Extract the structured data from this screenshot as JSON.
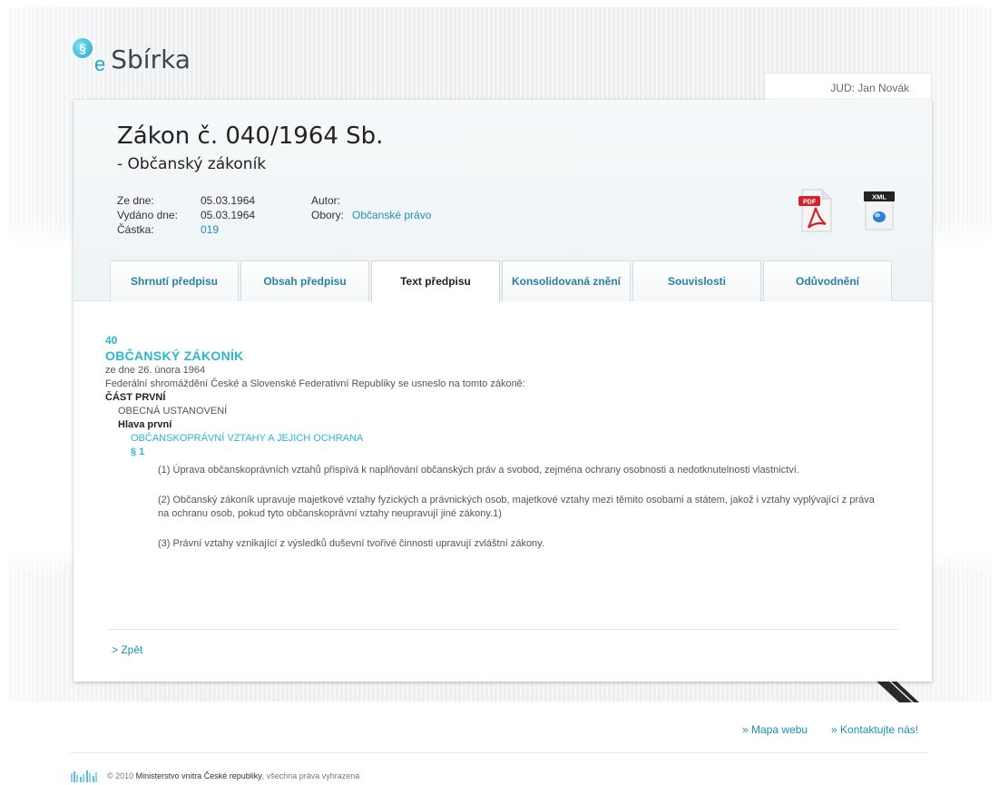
{
  "logo": {
    "mark": "§",
    "e": "e",
    "text": "Sbírka"
  },
  "user": {
    "name": "JUD: Jan Novák"
  },
  "law": {
    "title": "Zákon č. 040/1964 Sb.",
    "subtitle": "- Občanský zákoník",
    "meta_left": [
      {
        "label": "Ze dne:",
        "value": "05.03.1964",
        "is_link": false
      },
      {
        "label": "Vydáno dne:",
        "value": "05.03.1964",
        "is_link": false
      },
      {
        "label": "Částka:",
        "value": "019",
        "is_link": true
      }
    ],
    "meta_right": [
      {
        "label": "Autor:",
        "value": ""
      },
      {
        "label": "Obory:",
        "value": "Občanské právo"
      }
    ],
    "downloads": {
      "pdf_label": "PDF",
      "xml_label": "XML"
    }
  },
  "tabs": [
    {
      "label": "Shrnutí předpisu",
      "active": false
    },
    {
      "label": "Obsah předpisu",
      "active": false
    },
    {
      "label": "Text předpisu",
      "active": true
    },
    {
      "label": "Konsolidovaná znění",
      "active": false
    },
    {
      "label": "Souvislosti",
      "active": false
    },
    {
      "label": "Odůvodnění",
      "active": false
    }
  ],
  "content": {
    "number": "40",
    "title": "OBČANSKÝ ZÁKONÍK",
    "date": "ze dne 26. února 1964",
    "preamble": "Federální shromáždění České a Slovenské Federativní Republiky se usneslo na tomto zákoně:",
    "part": "ČÁST PRVNÍ",
    "part_title": "OBECNÁ USTANOVENÍ",
    "chapter": "Hlava první",
    "chapter_title": "OBČANSKOPRÁVNÍ VZTAHY A JEJICH OCHRANA",
    "section": "§ 1",
    "paragraphs": [
      "(1) Úprava občanskoprávních vztahů přispívá k naplňování občanských práv a svobod, zejména ochrany osobnosti a nedotknutelnosti vlastnictví.",
      "(2) Občanský zákoník upravuje majetkové vztahy fyzických a právnických osob, majetkové vztahy mezi těmito osobami a státem, jakož i vztahy vyplývající z práva na ochranu osob, pokud tyto občanskoprávní vztahy neupravují jiné zákony.1)",
      "(3) Právní vztahy vznikající z výsledků duševní tvořivé činnosti upravují zvláštní zákony."
    ]
  },
  "back": {
    "label": "> Zpět"
  },
  "footer": {
    "links": [
      "» Mapa webu",
      "» Kontaktujte nás!"
    ],
    "copyright_prefix": "© 2010",
    "ministry": "Ministerstvo vnitra České republiky",
    "rights": ", všechna práva vyhrazena"
  },
  "colors": {
    "accent": "#1b8fbd",
    "heading": "#2bb6d6"
  }
}
